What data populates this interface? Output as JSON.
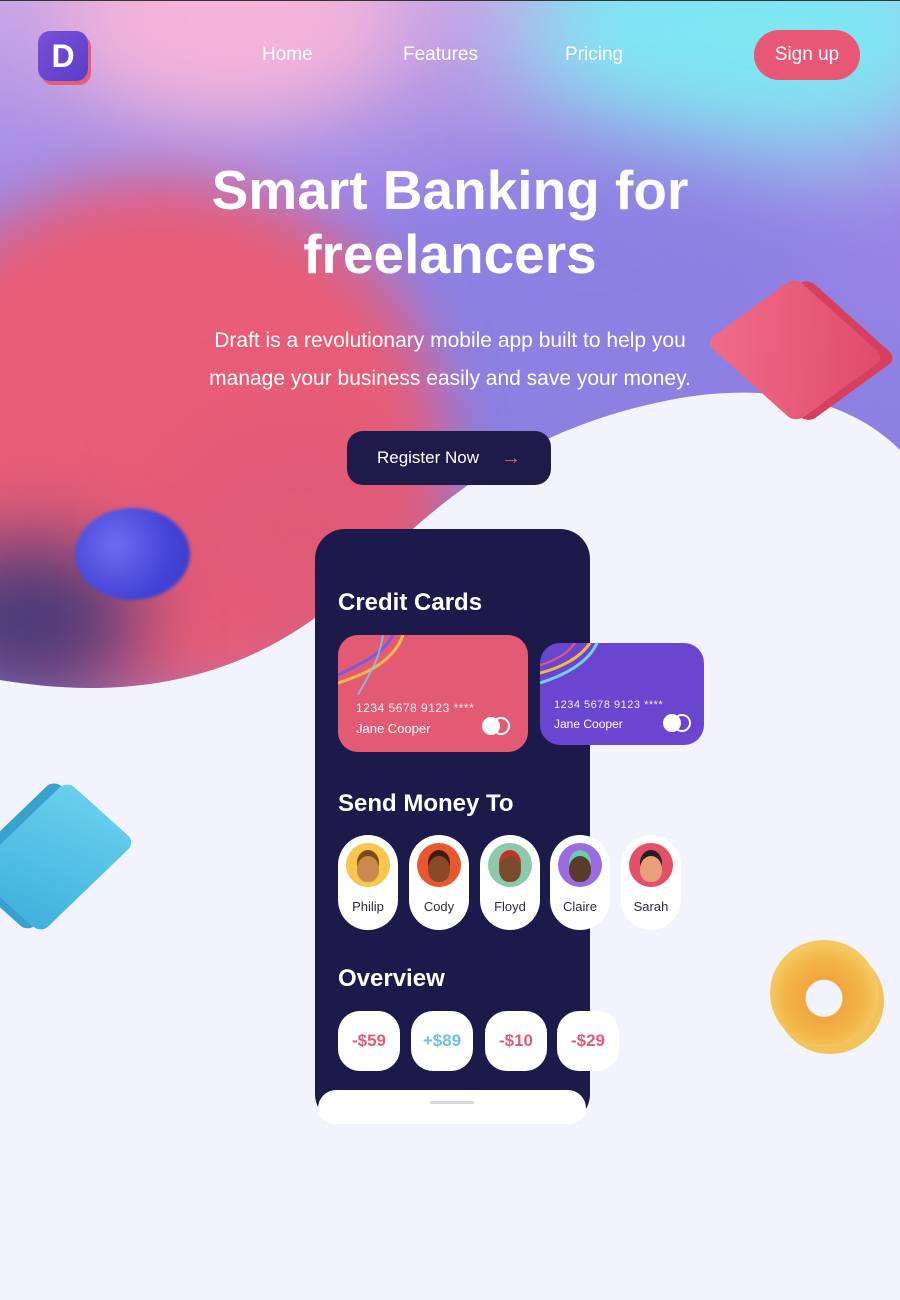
{
  "nav": {
    "logo_letter": "D",
    "links": [
      "Home",
      "Features",
      "Pricing"
    ],
    "signup_label": "Sign up"
  },
  "hero": {
    "title_line1": "Smart Banking for",
    "title_line2": "freelancers",
    "subtitle_line1": "Draft is a revolutionary mobile app built to help you",
    "subtitle_line2": "manage your business easily and save your money.",
    "cta_label": "Register Now",
    "cta_icon": "arrow-right-icon"
  },
  "phone": {
    "credit_cards_title": "Credit Cards",
    "cards": [
      {
        "number": "1234 5678 9123 ****",
        "holder": "Jane Cooper",
        "color": "#e35a75"
      },
      {
        "number": "1234 5678 9123 ****",
        "holder": "Jane Cooper",
        "color": "#6a45d0"
      }
    ],
    "send_money_title": "Send Money To",
    "contacts": [
      {
        "name": "Philip",
        "bg": "#f6c64d",
        "skin": "#c98a4b",
        "hair": "#7a4a1c"
      },
      {
        "name": "Cody",
        "bg": "#e9572f",
        "skin": "#8a4a2a",
        "hair": "#3a1e14"
      },
      {
        "name": "Floyd",
        "bg": "#8bc9a8",
        "skin": "#7a4a2a",
        "hair": "#c43030"
      },
      {
        "name": "Claire",
        "bg": "#9b6be0",
        "skin": "#5a3a2a",
        "hair": "#6dc9b0"
      },
      {
        "name": "Sarah",
        "bg": "#e3506a",
        "skin": "#e8a07a",
        "hair": "#2a1c1c"
      }
    ],
    "overview_title": "Overview",
    "overview": [
      {
        "amount": "-$59",
        "color": "#e35a75"
      },
      {
        "amount": "+$89",
        "color": "#6fc2dc"
      },
      {
        "amount": "-$10",
        "color": "#e35a75"
      },
      {
        "amount": "-$29",
        "color": "#e35a75"
      }
    ]
  },
  "colors": {
    "accent_pink": "#e85876",
    "navy": "#1e1b4b"
  }
}
